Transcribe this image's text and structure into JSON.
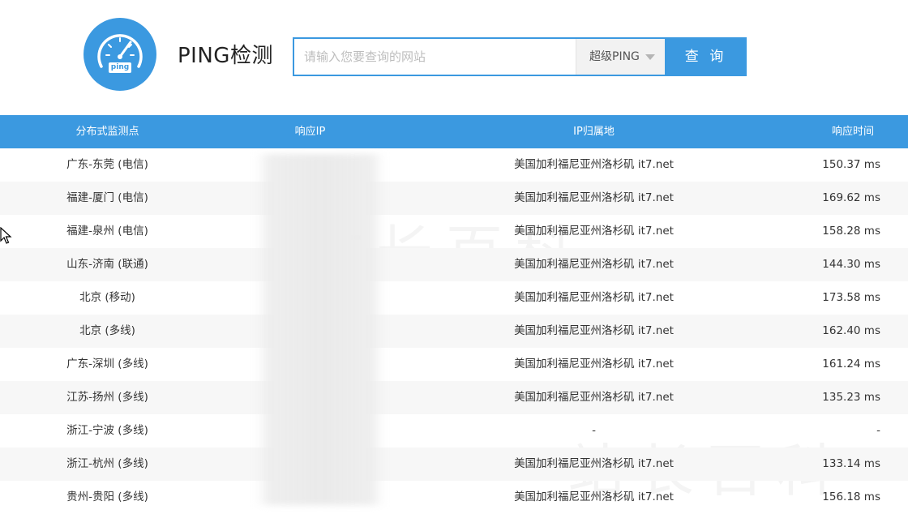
{
  "header": {
    "title": "PING检测",
    "logo_text": "ping",
    "search_placeholder": "请输入您要查询的网站",
    "search_value": "",
    "select_value": "超级PING",
    "query_button": "查 询"
  },
  "table": {
    "columns": [
      "分布式监测点",
      "响应IP",
      "IP归属地",
      "响应时间"
    ],
    "rows": [
      {
        "node": "广东-东莞 (电信)",
        "ip": "",
        "location": "美国加利福尼亚州洛杉矶 it7.net",
        "time": "150.37 ms"
      },
      {
        "node": "福建-厦门 (电信)",
        "ip": "",
        "location": "美国加利福尼亚州洛杉矶 it7.net",
        "time": "169.62 ms"
      },
      {
        "node": "福建-泉州 (电信)",
        "ip": "",
        "location": "美国加利福尼亚州洛杉矶 it7.net",
        "time": "158.28 ms"
      },
      {
        "node": "山东-济南 (联通)",
        "ip": "",
        "location": "美国加利福尼亚州洛杉矶 it7.net",
        "time": "144.30 ms"
      },
      {
        "node": "北京 (移动)",
        "ip": "",
        "location": "美国加利福尼亚州洛杉矶 it7.net",
        "time": "173.58 ms"
      },
      {
        "node": "北京 (多线)",
        "ip": "",
        "location": "美国加利福尼亚州洛杉矶 it7.net",
        "time": "162.40 ms"
      },
      {
        "node": "广东-深圳 (多线)",
        "ip": "",
        "location": "美国加利福尼亚州洛杉矶 it7.net",
        "time": "161.24 ms"
      },
      {
        "node": "江苏-扬州 (多线)",
        "ip": "",
        "location": "美国加利福尼亚州洛杉矶 it7.net",
        "time": "135.23 ms"
      },
      {
        "node": "浙江-宁波 (多线)",
        "ip": "",
        "location": "-",
        "time": "-"
      },
      {
        "node": "浙江-杭州 (多线)",
        "ip": "",
        "location": "美国加利福尼亚州洛杉矶 it7.net",
        "time": "133.14 ms"
      },
      {
        "node": "贵州-贵阳 (多线)",
        "ip": "",
        "location": "美国加利福尼亚州洛杉矶 it7.net",
        "time": "156.18 ms"
      }
    ]
  },
  "watermark": "站长百科",
  "colors": {
    "accent": "#3b99e0",
    "alt_row": "#f7f7f7"
  }
}
